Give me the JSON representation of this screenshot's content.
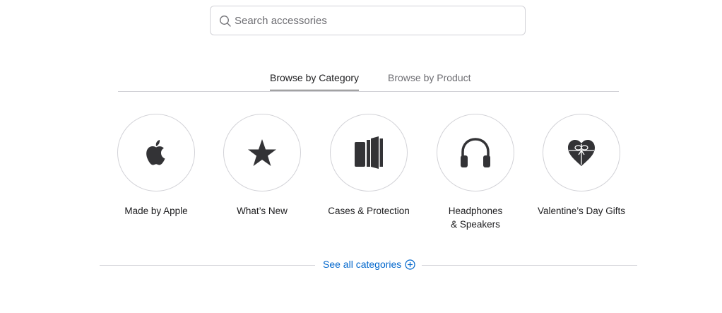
{
  "search": {
    "placeholder": "Search accessories",
    "value": ""
  },
  "tabs": [
    {
      "label": "Browse by Category",
      "active": true
    },
    {
      "label": "Browse by Product",
      "active": false
    }
  ],
  "categories": [
    {
      "label": "Made by Apple",
      "icon": "apple-icon"
    },
    {
      "label": "What’s New",
      "icon": "star-icon"
    },
    {
      "label": "Cases & Protection",
      "icon": "cases-icon"
    },
    {
      "label": "Headphones\n& Speakers",
      "icon": "headphones-icon"
    },
    {
      "label": "Valentine’s Day Gifts",
      "icon": "gift-heart-icon"
    }
  ],
  "see_all": {
    "label": "See all categories",
    "icon": "plus-circle-icon"
  },
  "colors": {
    "link": "#0066cc",
    "icon": "#333336",
    "border": "#d2d2d7"
  }
}
